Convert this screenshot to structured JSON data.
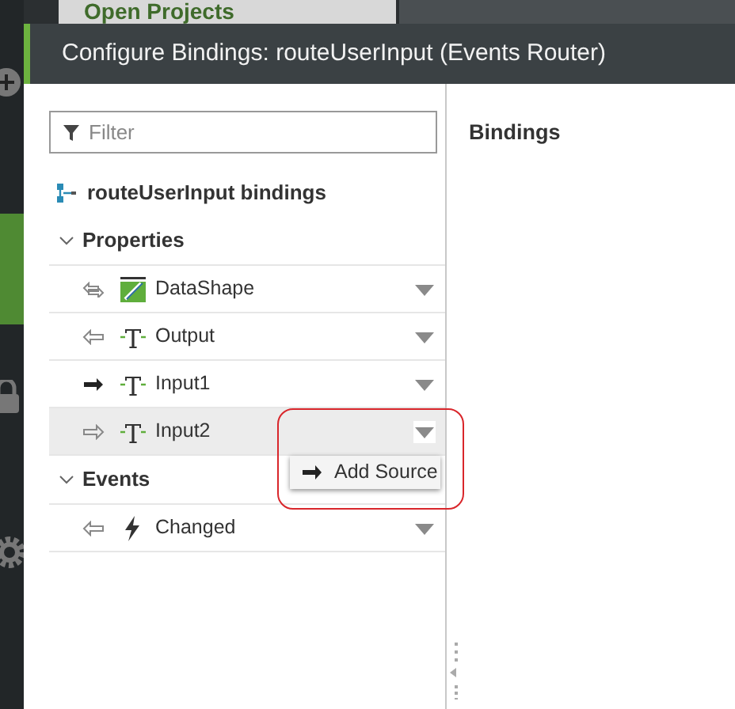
{
  "background": {
    "page_title": "Open Projects"
  },
  "dialog": {
    "title": "Configure Bindings: routeUserInput (Events Router)"
  },
  "filter": {
    "placeholder": "Filter"
  },
  "tree": {
    "title": "routeUserInput bindings",
    "sections": [
      {
        "label": "Properties",
        "expanded": true,
        "rows": [
          {
            "label": "DataShape",
            "kind": "datashape",
            "inbound": true,
            "outbound": true,
            "bound": false,
            "selected": false
          },
          {
            "label": "Output",
            "kind": "text",
            "inbound": true,
            "outbound": false,
            "bound": false,
            "selected": false
          },
          {
            "label": "Input1",
            "kind": "text",
            "inbound": false,
            "outbound": true,
            "bound": true,
            "selected": false
          },
          {
            "label": "Input2",
            "kind": "text",
            "inbound": false,
            "outbound": true,
            "bound": false,
            "selected": true,
            "menu_open": true,
            "menu": [
              "Add Source"
            ]
          }
        ]
      },
      {
        "label": "Events",
        "expanded": true,
        "rows": [
          {
            "label": "Changed",
            "kind": "event",
            "inbound": true,
            "outbound": false,
            "bound": false,
            "selected": false
          }
        ]
      }
    ]
  },
  "bindings_panel": {
    "title": "Bindings"
  }
}
